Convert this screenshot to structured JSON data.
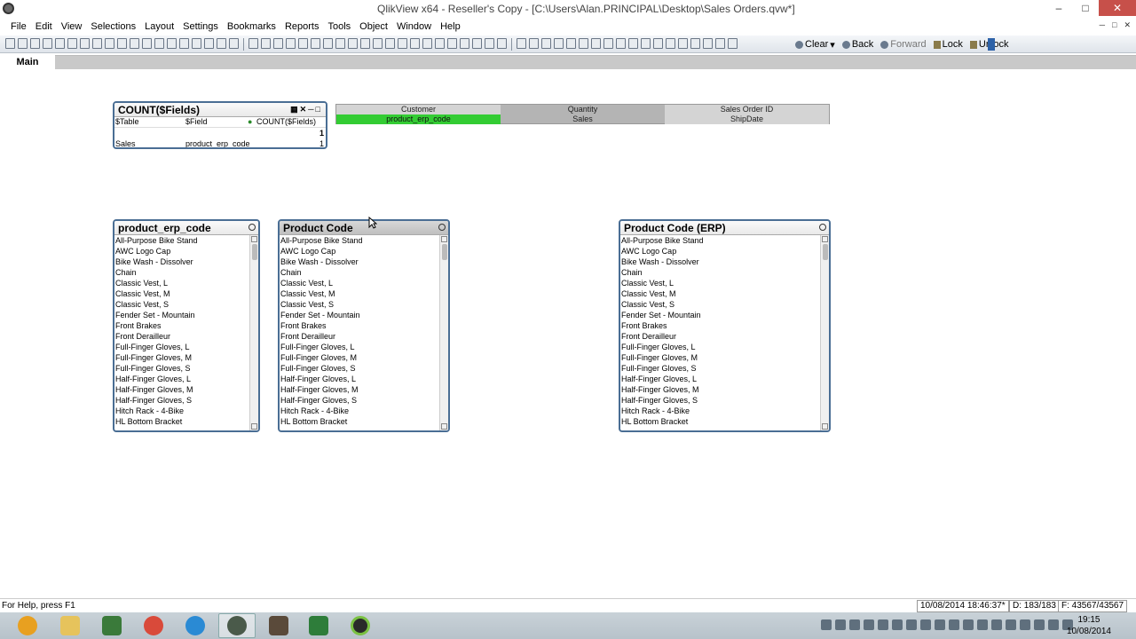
{
  "window": {
    "title": "QlikView x64 - Reseller's Copy - [C:\\Users\\Alan.PRINCIPAL\\Desktop\\Sales Orders.qvw*]",
    "minimize": "–",
    "maximize": "□",
    "close": "✕"
  },
  "menu": {
    "items": [
      "File",
      "Edit",
      "View",
      "Selections",
      "Layout",
      "Settings",
      "Bookmarks",
      "Reports",
      "Tools",
      "Object",
      "Window",
      "Help"
    ]
  },
  "toolbar": {
    "clear": "Clear",
    "back": "Back",
    "forward": "Forward",
    "lock": "Lock",
    "unlock": "Unlock"
  },
  "tabs": {
    "main": "Main"
  },
  "count_box": {
    "title": "COUNT($Fields)",
    "headers": [
      "$Table",
      "$Field",
      "COUNT($Fields)"
    ],
    "total": "1",
    "rows": [
      {
        "table": "Sales",
        "field": "product_erp_code",
        "count": "1"
      }
    ]
  },
  "current_selections": {
    "row1": [
      "Customer",
      "Quantity",
      "Sales Order ID"
    ],
    "row2": [
      "product_erp_code",
      "Sales",
      "ShipDate"
    ]
  },
  "listboxes": [
    {
      "title": "product_erp_code",
      "items": [
        "All-Purpose Bike Stand",
        "AWC Logo Cap",
        "Bike Wash - Dissolver",
        "Chain",
        "Classic Vest, L",
        "Classic Vest, M",
        "Classic Vest, S",
        "Fender Set - Mountain",
        "Front Brakes",
        "Front Derailleur",
        "Full-Finger Gloves, L",
        "Full-Finger Gloves, M",
        "Full-Finger Gloves, S",
        "Half-Finger Gloves, L",
        "Half-Finger Gloves, M",
        "Half-Finger Gloves, S",
        "Hitch Rack - 4-Bike",
        "HL Bottom Bracket"
      ]
    },
    {
      "title": "Product Code",
      "items": [
        "All-Purpose Bike Stand",
        "AWC Logo Cap",
        "Bike Wash - Dissolver",
        "Chain",
        "Classic Vest, L",
        "Classic Vest, M",
        "Classic Vest, S",
        "Fender Set - Mountain",
        "Front Brakes",
        "Front Derailleur",
        "Full-Finger Gloves, L",
        "Full-Finger Gloves, M",
        "Full-Finger Gloves, S",
        "Half-Finger Gloves, L",
        "Half-Finger Gloves, M",
        "Half-Finger Gloves, S",
        "Hitch Rack - 4-Bike",
        "HL Bottom Bracket"
      ]
    },
    {
      "title": "Product Code (ERP)",
      "items": [
        "All-Purpose Bike Stand",
        "AWC Logo Cap",
        "Bike Wash - Dissolver",
        "Chain",
        "Classic Vest, L",
        "Classic Vest, M",
        "Classic Vest, S",
        "Fender Set - Mountain",
        "Front Brakes",
        "Front Derailleur",
        "Full-Finger Gloves, L",
        "Full-Finger Gloves, M",
        "Full-Finger Gloves, S",
        "Half-Finger Gloves, L",
        "Half-Finger Gloves, M",
        "Half-Finger Gloves, S",
        "Hitch Rack - 4-Bike",
        "HL Bottom Bracket"
      ]
    }
  ],
  "status": {
    "help": "For Help, press F1",
    "timestamp": "10/08/2014 18:46:37*",
    "distinct": "D: 183/183",
    "frequency": "F: 43567/43567"
  },
  "clock": {
    "time": "19:15",
    "date": "10/08/2014"
  },
  "colors": {
    "selected": "#33cc33",
    "frame": "#4a6e94",
    "close_btn": "#c7504a"
  }
}
